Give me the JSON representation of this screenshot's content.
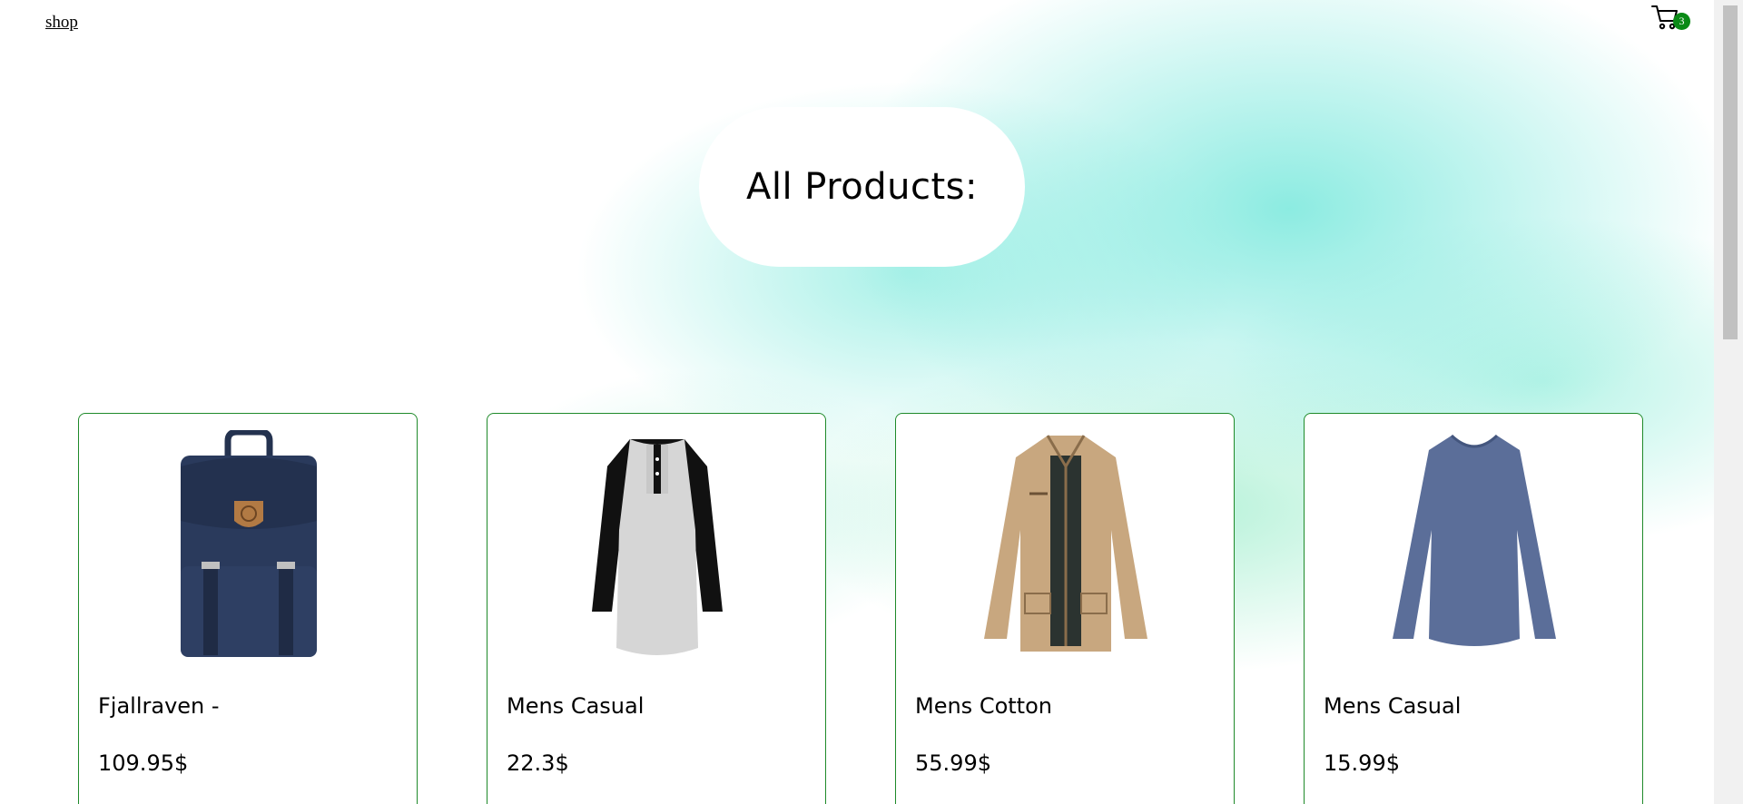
{
  "nav": {
    "shop_label": "shop",
    "cart": {
      "icon": "cart-icon",
      "count": "3",
      "badge_color": "#0a8a16"
    }
  },
  "hero": {
    "title": "All Products:"
  },
  "products": [
    {
      "title": "Fjallraven -",
      "price": "109.95$",
      "icon": "backpack-image"
    },
    {
      "title": "Mens Casual",
      "price": "22.3$",
      "icon": "raglan-shirt-image"
    },
    {
      "title": "Mens Cotton",
      "price": "55.99$",
      "icon": "cotton-jacket-image"
    },
    {
      "title": "Mens Casual",
      "price": "15.99$",
      "icon": "long-sleeve-shirt-image"
    }
  ],
  "colors": {
    "card_border": "#1f8a2a",
    "background_accent": "#8ee9dc"
  }
}
